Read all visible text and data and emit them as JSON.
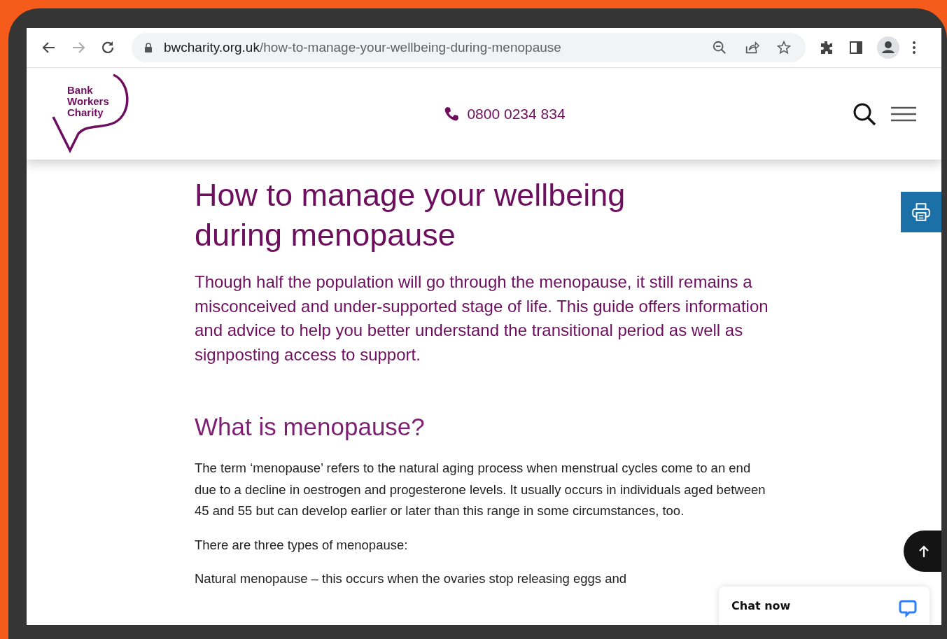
{
  "browser": {
    "url_host": "bwcharity.org.uk",
    "url_path": "/how-to-manage-your-wellbeing-during-menopause"
  },
  "site_header": {
    "logo_lines": [
      "Bank",
      "Workers",
      "Charity"
    ],
    "phone": "0800 0234 834"
  },
  "article": {
    "title": "How to manage your wellbeing during menopause",
    "intro": "Though half the population will go through the menopause, it still remains a misconceived and under-supported stage of life. This guide offers information and advice to help you better understand the transitional period as well as signposting access to support.",
    "heading": "What is menopause?",
    "paragraphs": [
      "The term ‘menopause’ refers to the natural aging process when menstrual cycles come to an end due to a decline in oestrogen and progesterone levels. It usually occurs in individuals aged between 45 and 55 but can develop earlier or later than this range in some circumstances, too.",
      "There are three types of menopause:",
      "Natural menopause – this occurs when the ovaries stop releasing eggs and"
    ]
  },
  "chat": {
    "label": "Chat now"
  }
}
